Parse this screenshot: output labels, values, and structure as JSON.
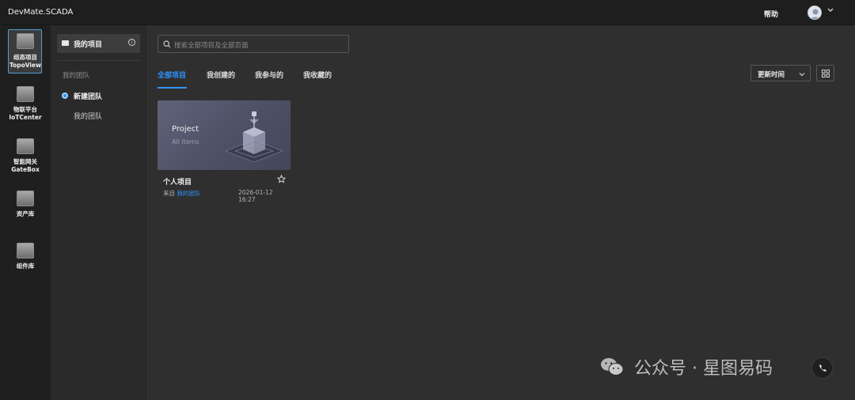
{
  "header": {
    "app_title": "DevMate.SCADA",
    "help_label": "帮助"
  },
  "rail": {
    "items": [
      {
        "label_line1": "组态项目",
        "label_line2": "TopoView"
      },
      {
        "label_line1": "物联平台",
        "label_line2": "IoTCenter"
      },
      {
        "label_line1": "智能网关",
        "label_line2": "GateBox"
      },
      {
        "label_line1": "资产库",
        "label_line2": ""
      },
      {
        "label_line1": "组件库",
        "label_line2": ""
      }
    ]
  },
  "sidebar": {
    "my_projects": "我的项目",
    "section_label": "我的团队",
    "new_team": "新建团队",
    "my_team": "我的团队"
  },
  "search": {
    "placeholder": "搜索全部项目及全部页面"
  },
  "tabs": [
    {
      "label": "全部项目"
    },
    {
      "label": "我创建的"
    },
    {
      "label": "我参与的"
    },
    {
      "label": "我收藏的"
    }
  ],
  "sort": {
    "label": "更新时间"
  },
  "card": {
    "thumb_title": "Project",
    "thumb_subtitle": "All items",
    "name": "个人项目",
    "from_prefix": "来自",
    "from_link": "我的团队",
    "date": "2026-01-12 16:27"
  },
  "watermark": {
    "text": "公众号 · 星图易码"
  },
  "colors": {
    "accent": "#2f95ff",
    "topbar": "#1e1e1e",
    "background": "#2f2f2f"
  }
}
